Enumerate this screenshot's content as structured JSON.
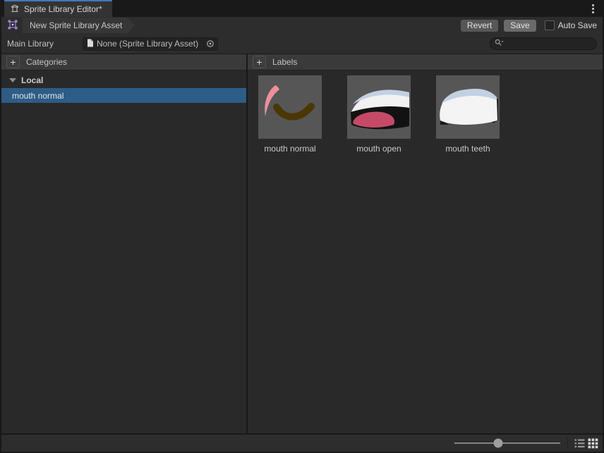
{
  "window": {
    "tab_title": "Sprite Library Editor*",
    "menu_icon": "kebab-vertical"
  },
  "toolbar": {
    "breadcrumb": "New Sprite Library Asset",
    "revert_label": "Revert",
    "save_label": "Save",
    "auto_save_label": "Auto Save",
    "auto_save_checked": false
  },
  "main_library": {
    "label": "Main Library",
    "object_field_value": "None (Sprite Library Asset)",
    "object_picker_icon": "target-circle",
    "search": {
      "value": "",
      "placeholder": ""
    }
  },
  "categories_panel": {
    "add_button": "+",
    "title": "Categories",
    "groups": [
      {
        "label": "Local",
        "expanded": true,
        "items": [
          {
            "label": "mouth normal",
            "selected": true
          }
        ]
      }
    ]
  },
  "labels_panel": {
    "add_button": "+",
    "title": "Labels",
    "items": [
      {
        "label": "mouth normal"
      },
      {
        "label": "mouth open"
      },
      {
        "label": "mouth teeth"
      }
    ]
  },
  "bottom_bar": {
    "slider_value": 0.41,
    "view_modes": [
      "list",
      "grid"
    ],
    "active_view": "grid"
  },
  "colors": {
    "selection_blue": "#2d5c87",
    "tab_highlight_blue": "#3e79bb",
    "breadcrumb_icon_purple": "#a184e0",
    "panel_header_gray": "#3a3a3a",
    "content_gray": "#292929",
    "thumbnail_bg_gray": "#565656"
  },
  "icons": {
    "tab": "sprite-library-icon",
    "breadcrumb": "sprite-asset-icon",
    "object_field": "document-icon",
    "search": "magnifier-with-caret",
    "bottom_right": [
      "list-view-icon",
      "grid-view-icon"
    ]
  }
}
